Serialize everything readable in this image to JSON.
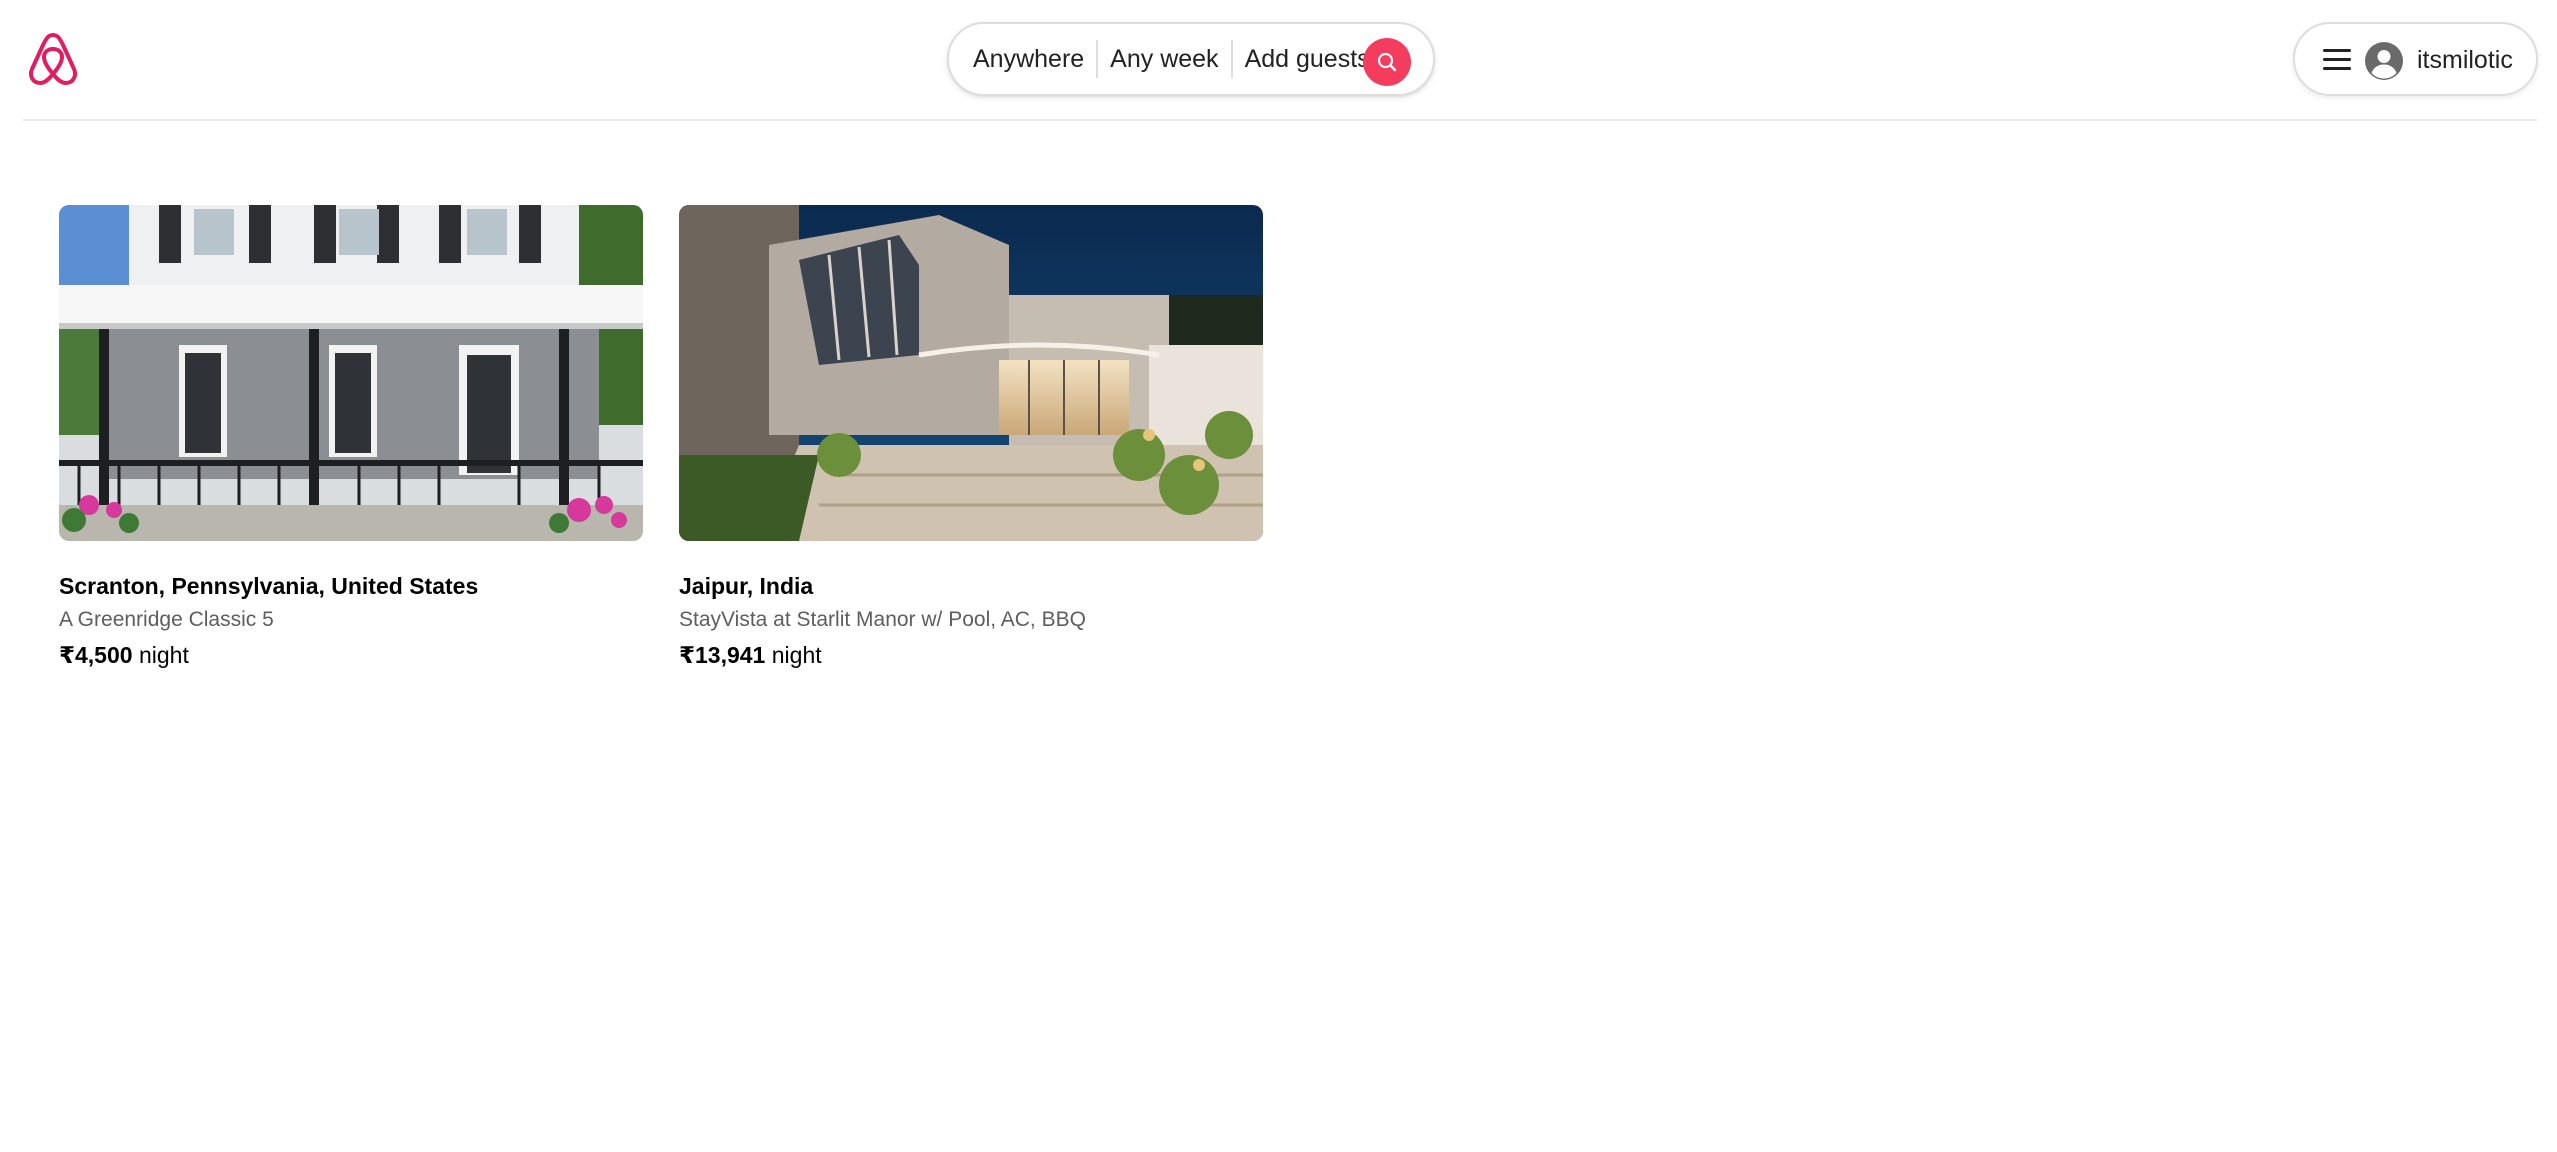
{
  "header": {
    "logo_icon": "airbnb-logo-icon",
    "brand_color": "#e31c5f",
    "search": {
      "location": "Anywhere",
      "dates": "Any week",
      "guests": "Add guests",
      "button_icon": "search-icon",
      "button_color": "#f43d5e"
    },
    "user_menu": {
      "menu_icon": "hamburger-menu-icon",
      "avatar_icon": "user-avatar-icon",
      "username": "itsmilotic"
    }
  },
  "listings": [
    {
      "location": "Scranton, Pennsylvania, United States",
      "title": "A Greenridge Classic 5",
      "price": "₹4,500",
      "unit": "night",
      "photo": "white-house-with-porch-photo"
    },
    {
      "location": "Jaipur, India",
      "title": "StayVista at Starlit Manor w/ Pool, AC, BBQ",
      "price": "₹13,941",
      "unit": "night",
      "photo": "modern-villa-with-pool-at-night-photo"
    }
  ]
}
